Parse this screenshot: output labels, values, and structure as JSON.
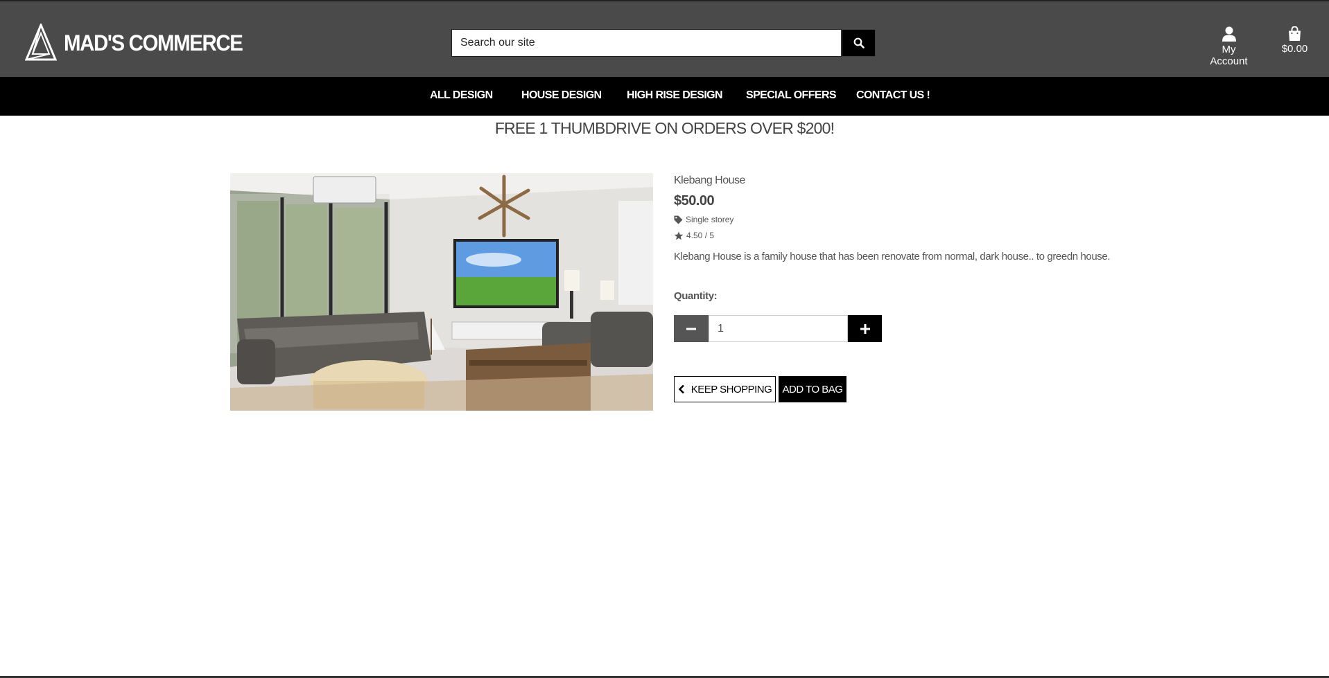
{
  "brand": {
    "name": "MAD'S COMMERCE",
    "logo_icon": "triangle-logo-icon"
  },
  "search": {
    "placeholder": "Search our site",
    "value": "",
    "icon": "search-icon"
  },
  "header": {
    "account_label": "My Account",
    "account_icon": "user-icon",
    "bag_total": "$0.00",
    "bag_icon": "shopping-bag-icon"
  },
  "nav": {
    "items": [
      {
        "label": "ALL DESIGN"
      },
      {
        "label": "HOUSE DESIGN"
      },
      {
        "label": "HIGH RISE DESIGN"
      },
      {
        "label": "SPECIAL OFFERS"
      },
      {
        "label": "CONTACT US !"
      }
    ]
  },
  "promo": {
    "text": "FREE 1 THUMBDRIVE ON ORDERS OVER $200!"
  },
  "product": {
    "name": "Klebang House",
    "price": "$50.00",
    "category": "Single storey",
    "category_icon": "tag-icon",
    "rating": "4.50 / 5",
    "rating_icon": "star-icon",
    "description": "Klebang House is a family house that has been renovate from normal, dark house.. to greedn house."
  },
  "quantity": {
    "label": "Quantity:",
    "value": "1"
  },
  "actions": {
    "keep_shopping": "KEEP SHOPPING",
    "add_to_bag": "ADD TO BAG"
  },
  "colors": {
    "header_bg": "#4a4a4a",
    "nav_bg": "#000000",
    "accent": "#000000"
  }
}
